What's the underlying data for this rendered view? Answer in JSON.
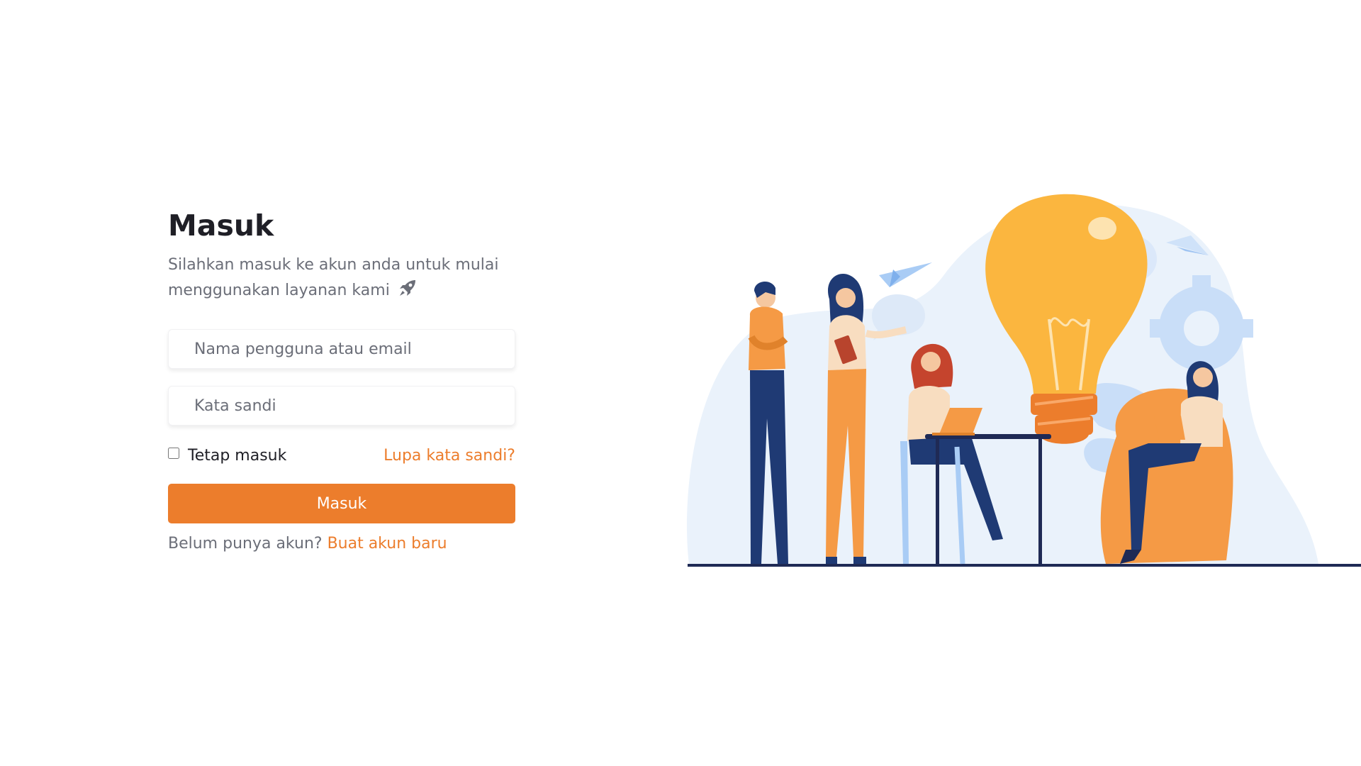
{
  "login": {
    "title": "Masuk",
    "subtitle": "Silahkan masuk ke akun anda untuk mulai menggunakan layanan kami",
    "subtitle_icon": "rocket-icon",
    "username_placeholder": "Nama pengguna atau email",
    "username_value": "",
    "password_placeholder": "Kata sandi",
    "password_value": "",
    "remember_label": "Tetap masuk",
    "remember_checked": false,
    "forgot_label": "Lupa kata sandi?",
    "submit_label": "Masuk",
    "signup_prompt": "Belum punya akun?",
    "signup_link": "Buat akun baru"
  },
  "illustration": {
    "subject": "team-idea-lightbulb-illustration"
  },
  "colors": {
    "accent": "#ec7d2c",
    "text_dark": "#1f1f26",
    "text_muted": "#6b6e78",
    "bulb": "#fbb63f",
    "navy": "#1f3a74",
    "blob": "#eaf2fb"
  }
}
